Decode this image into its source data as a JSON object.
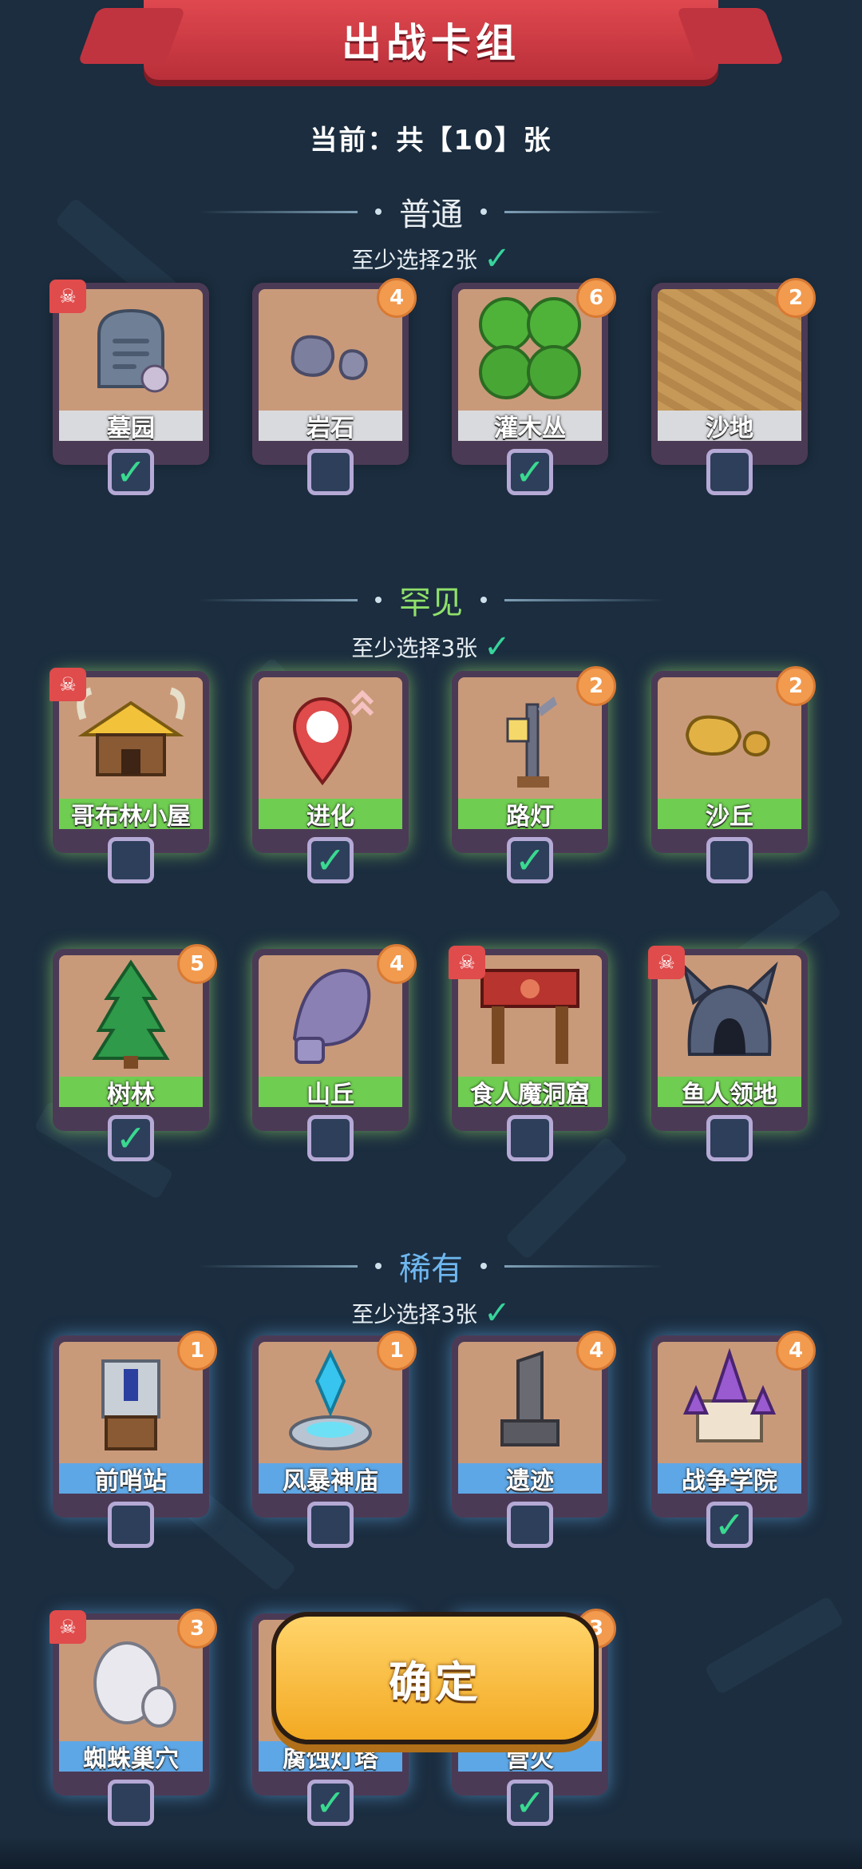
{
  "header": {
    "title": "出战卡组",
    "count_line": "当前：共【10】张"
  },
  "colors": {
    "check": "#39d98f",
    "common_label": "#d9dadd",
    "uncommon_label": "#6fce51",
    "rare_label": "#5ea7e6",
    "badge": "#f29a4e",
    "banner": "#c03440",
    "confirm": "#f3a922"
  },
  "sections": [
    {
      "title": "普通",
      "requirement": "至少选择2张",
      "title_color": "#e9eef2",
      "cards": [
        {
          "name": "墓园",
          "count": "",
          "skull": true,
          "checked": true,
          "icon": "tombstone-icon"
        },
        {
          "name": "岩石",
          "count": "4",
          "skull": false,
          "checked": false,
          "icon": "rock-icon"
        },
        {
          "name": "灌木丛",
          "count": "6",
          "skull": false,
          "checked": true,
          "icon": "bush-icon"
        },
        {
          "name": "沙地",
          "count": "2",
          "skull": false,
          "checked": false,
          "icon": "sand-icon"
        }
      ]
    },
    {
      "title": "罕见",
      "requirement": "至少选择3张",
      "title_color": "#8fe06a",
      "cards": [
        {
          "name": "哥布林小屋",
          "count": "",
          "skull": true,
          "checked": false,
          "icon": "goblin-hut-icon"
        },
        {
          "name": "进化",
          "count": "",
          "skull": false,
          "checked": true,
          "icon": "evolution-icon"
        },
        {
          "name": "路灯",
          "count": "2",
          "skull": false,
          "checked": true,
          "icon": "streetlamp-icon"
        },
        {
          "name": "沙丘",
          "count": "2",
          "skull": false,
          "checked": false,
          "icon": "dune-icon"
        },
        {
          "name": "树林",
          "count": "5",
          "skull": false,
          "checked": true,
          "icon": "tree-icon"
        },
        {
          "name": "山丘",
          "count": "4",
          "skull": false,
          "checked": false,
          "icon": "hill-icon"
        },
        {
          "name": "食人魔洞窟",
          "count": "",
          "skull": true,
          "checked": false,
          "icon": "ogre-cave-icon"
        },
        {
          "name": "鱼人领地",
          "count": "",
          "skull": true,
          "checked": false,
          "icon": "murloc-lair-icon"
        }
      ]
    },
    {
      "title": "稀有",
      "requirement": "至少选择3张",
      "title_color": "#6fb7ef",
      "cards": [
        {
          "name": "前哨站",
          "count": "1",
          "skull": false,
          "checked": false,
          "icon": "outpost-icon"
        },
        {
          "name": "风暴神庙",
          "count": "1",
          "skull": false,
          "checked": false,
          "icon": "storm-temple-icon"
        },
        {
          "name": "遗迹",
          "count": "4",
          "skull": false,
          "checked": false,
          "icon": "ruins-icon"
        },
        {
          "name": "战争学院",
          "count": "4",
          "skull": false,
          "checked": true,
          "icon": "war-academy-icon"
        },
        {
          "name": "蜘蛛巢穴",
          "count": "3",
          "skull": true,
          "checked": false,
          "icon": "spider-nest-icon"
        },
        {
          "name": "腐蚀灯塔",
          "count": "",
          "skull": false,
          "checked": true,
          "icon": "tower-icon"
        },
        {
          "name": "营火",
          "count": "3",
          "skull": false,
          "checked": true,
          "icon": "campfire-icon"
        }
      ]
    }
  ],
  "confirm_button": "确定"
}
